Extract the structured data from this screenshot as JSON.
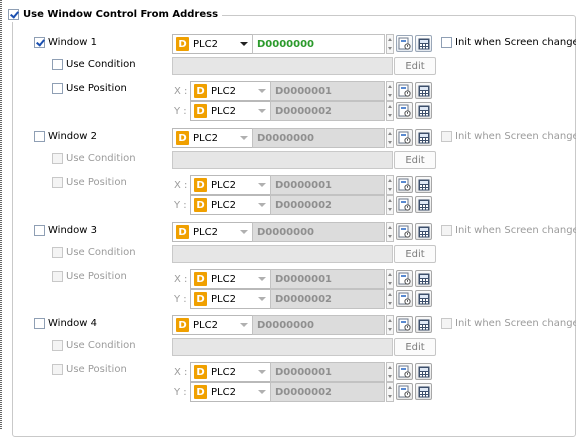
{
  "group": {
    "title": "Use Window Control From Address",
    "checked": true
  },
  "windows": [
    {
      "label": "Window 1",
      "checked": true,
      "plc": "PLC2",
      "address": "D0000000",
      "init_label": "Init when Screen changes",
      "use_condition": "Use Condition",
      "edit": "Edit",
      "use_position": "Use Position",
      "x_label": "X :",
      "x_plc": "PLC2",
      "x_addr": "D0000001",
      "y_label": "Y :",
      "y_plc": "PLC2",
      "y_addr": "D0000002"
    },
    {
      "label": "Window 2",
      "checked": false,
      "plc": "PLC2",
      "address": "D0000000",
      "init_label": "Init when Screen changes",
      "use_condition": "Use Condition",
      "edit": "Edit",
      "use_position": "Use Position",
      "x_label": "X :",
      "x_plc": "PLC2",
      "x_addr": "D0000001",
      "y_label": "Y :",
      "y_plc": "PLC2",
      "y_addr": "D0000002"
    },
    {
      "label": "Window 3",
      "checked": false,
      "plc": "PLC2",
      "address": "D0000000",
      "init_label": "Init when Screen changes",
      "use_condition": "Use Condition",
      "edit": "Edit",
      "use_position": "Use Position",
      "x_label": "X :",
      "x_plc": "PLC2",
      "x_addr": "D0000001",
      "y_label": "Y :",
      "y_plc": "PLC2",
      "y_addr": "D0000002"
    },
    {
      "label": "Window 4",
      "checked": false,
      "plc": "PLC2",
      "address": "D0000000",
      "init_label": "Init when Screen changes",
      "use_condition": "Use Condition",
      "edit": "Edit",
      "use_position": "Use Position",
      "x_label": "X :",
      "x_plc": "PLC2",
      "x_addr": "D0000001",
      "y_label": "Y :",
      "y_plc": "PLC2",
      "y_addr": "D0000002"
    }
  ],
  "icons": {
    "plc_device": "D",
    "address-book": "address-book-icon",
    "keypad": "keypad-icon"
  }
}
